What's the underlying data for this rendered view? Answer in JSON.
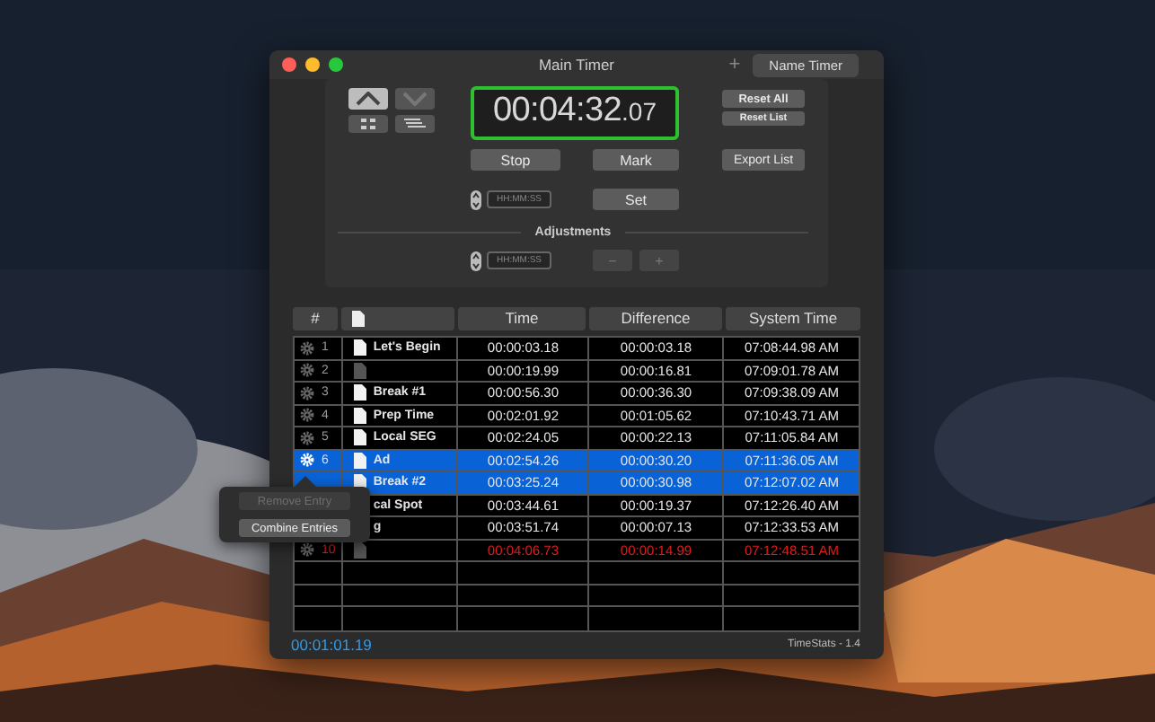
{
  "window": {
    "title": "Main Timer",
    "add_symbol": "+",
    "name_button": "Name Timer"
  },
  "controls": {
    "view_buttons": [
      {
        "kind": "up",
        "selected": true
      },
      {
        "kind": "down",
        "selected": false
      }
    ],
    "small_buttons": [
      {
        "kind": "grid"
      },
      {
        "kind": "list"
      }
    ],
    "timer": {
      "main": "00:04:32",
      "fraction": ".07",
      "running": true
    },
    "reset_all": "Reset All",
    "reset_list": "Reset List",
    "stop": "Stop",
    "mark": "Mark",
    "export": "Export List",
    "set_field": {
      "placeholder": "HH:MM:SS"
    },
    "set": "Set",
    "adjustments": {
      "label": "Adjustments",
      "field": {
        "placeholder": "HH:MM:SS"
      },
      "buttons": [
        {
          "label": "−",
          "disabled": true
        },
        {
          "label": "+",
          "disabled": true
        }
      ]
    }
  },
  "table": {
    "columns": [
      "#",
      "Time",
      "Difference",
      "System Time"
    ],
    "rows": [
      {
        "kind": "entry",
        "gear": true,
        "number": "1",
        "doc_dim": false,
        "name": "Let's Begin",
        "time": "00:00:03.18",
        "difference": "00:00:03.18",
        "system_time": "07:08:44.98 AM",
        "selected": false,
        "alert": false
      },
      {
        "kind": "entry",
        "gear": true,
        "number": "2",
        "doc_dim": true,
        "time": "00:00:19.99",
        "difference": "00:00:16.81",
        "system_time": "07:09:01.78 AM",
        "selected": false,
        "alert": false
      },
      {
        "kind": "entry",
        "gear": true,
        "number": "3",
        "doc_dim": false,
        "name": "Break #1",
        "time": "00:00:56.30",
        "difference": "00:00:36.30",
        "system_time": "07:09:38.09 AM",
        "selected": false,
        "alert": false
      },
      {
        "kind": "entry",
        "gear": true,
        "number": "4",
        "doc_dim": false,
        "name": "Prep Time",
        "time": "00:02:01.92",
        "difference": "00:01:05.62",
        "system_time": "07:10:43.71 AM",
        "selected": false,
        "alert": false
      },
      {
        "kind": "entry",
        "gear": true,
        "number": "5",
        "doc_dim": false,
        "name": "Local SEG",
        "time": "00:02:24.05",
        "difference": "00:00:22.13",
        "system_time": "07:11:05.84 AM",
        "selected": false,
        "alert": false
      },
      {
        "kind": "entry",
        "gear": true,
        "number": "6",
        "doc_dim": false,
        "name": "Ad",
        "time": "00:02:54.26",
        "difference": "00:00:30.20",
        "system_time": "07:11:36.05 AM",
        "selected": true,
        "alert": false
      },
      {
        "kind": "entry",
        "gear": false,
        "doc_dim": false,
        "name": "Break #2",
        "time": "00:03:25.24",
        "difference": "00:00:30.98",
        "system_time": "07:12:07.02 AM",
        "selected": true,
        "alert": false
      },
      {
        "kind": "entry",
        "gear": false,
        "name": "cal Spot",
        "time": "00:03:44.61",
        "difference": "00:00:19.37",
        "system_time": "07:12:26.40 AM",
        "selected": false,
        "alert": false
      },
      {
        "kind": "entry",
        "gear": false,
        "name": "g",
        "time": "00:03:51.74",
        "difference": "00:00:07.13",
        "system_time": "07:12:33.53 AM",
        "selected": false,
        "alert": false
      },
      {
        "kind": "entry",
        "gear": true,
        "number": "10",
        "doc_dim": true,
        "time": "00:04:06.73",
        "difference": "00:00:14.99",
        "system_time": "07:12:48.51 AM",
        "selected": false,
        "alert": true
      },
      {
        "kind": "empty"
      },
      {
        "kind": "empty"
      },
      {
        "kind": "empty"
      }
    ]
  },
  "footer": {
    "elapsed": "00:01:01.19",
    "version": "TimeStats - 1.4"
  },
  "context_menu": {
    "items": [
      {
        "label": "Remove Entry",
        "disabled": true
      },
      {
        "label": "Combine Entries",
        "disabled": false
      }
    ]
  }
}
